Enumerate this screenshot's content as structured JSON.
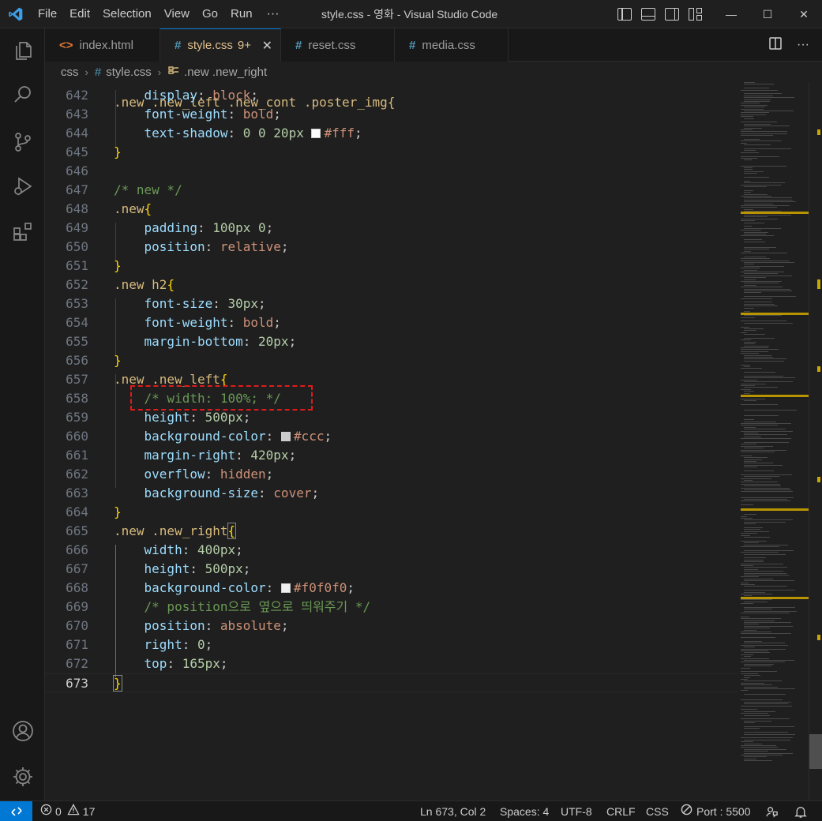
{
  "window": {
    "title": "style.css - 영화 - Visual Studio Code",
    "menu": [
      "File",
      "Edit",
      "Selection",
      "View",
      "Go",
      "Run"
    ],
    "more": "···",
    "controls": {
      "minimize": "—",
      "maximize": "☐",
      "close": "✕"
    }
  },
  "tabs": [
    {
      "label": "index.html",
      "icon": "<>",
      "active": false
    },
    {
      "label": "style.css",
      "icon": "#",
      "badge": "9+",
      "active": true,
      "close": "✕"
    },
    {
      "label": "reset.css",
      "icon": "#",
      "active": false
    },
    {
      "label": "media.css",
      "icon": "#",
      "active": false
    }
  ],
  "breadcrumb": {
    "folder": "css",
    "file": "style.css",
    "symbol": ".new .new_right"
  },
  "editor": {
    "first_partial_line": ".new .new_left .new_cont .poster_img{",
    "line_numbers": [
      "642",
      "643",
      "644",
      "645",
      "646",
      "647",
      "648",
      "649",
      "650",
      "651",
      "652",
      "653",
      "654",
      "655",
      "656",
      "657",
      "658",
      "659",
      "660",
      "661",
      "662",
      "663",
      "664",
      "665",
      "666",
      "667",
      "668",
      "669",
      "670",
      "671",
      "672",
      "673"
    ],
    "current_line": "673",
    "lines": {
      "l642": {
        "prop": "display",
        "value": "block"
      },
      "l643": {
        "prop": "font-weight",
        "value": "bold"
      },
      "l644": {
        "prop": "text-shadow",
        "value": "0 0 20px",
        "color": "#fff"
      },
      "l647": "/* new */",
      "l648": ".new",
      "l649": {
        "prop": "padding",
        "value": "100px 0"
      },
      "l650": {
        "prop": "position",
        "value": "relative"
      },
      "l652": ".new h2",
      "l653": {
        "prop": "font-size",
        "value": "30px"
      },
      "l654": {
        "prop": "font-weight",
        "value": "bold"
      },
      "l655": {
        "prop": "margin-bottom",
        "value": "20px"
      },
      "l657": ".new .new_left",
      "l658": "/* width: 100%; */",
      "l659": {
        "prop": "height",
        "value": "500px"
      },
      "l660": {
        "prop": "background-color",
        "color": "#ccc"
      },
      "l661": {
        "prop": "margin-right",
        "value": "420px"
      },
      "l662": {
        "prop": "overflow",
        "value": "hidden"
      },
      "l663": {
        "prop": "background-size",
        "value": "cover"
      },
      "l665": ".new .new_right",
      "l666": {
        "prop": "width",
        "value": "400px"
      },
      "l667": {
        "prop": "height",
        "value": "500px"
      },
      "l668": {
        "prop": "background-color",
        "color": "#f0f0f0"
      },
      "l669": "/* position으로 옆으로 띄워주기 */",
      "l670": {
        "prop": "position",
        "value": "absolute"
      },
      "l671": {
        "prop": "right",
        "value": "0"
      },
      "l672": {
        "prop": "top",
        "value": "165px"
      }
    }
  },
  "status": {
    "errors": "0",
    "warnings": "17",
    "position": "Ln 673, Col 2",
    "spaces": "Spaces: 4",
    "encoding": "UTF-8",
    "eol": "CRLF",
    "language": "CSS",
    "port": "Port : 5500"
  },
  "colors": {
    "accent": "#0078d4",
    "highlight": "#e01b1b",
    "selector": "#d7ba7d",
    "property": "#9cdcfe",
    "value": "#ce9178",
    "number": "#b5cea8",
    "comment": "#6a9955"
  },
  "icons": [
    "vscode-logo-icon",
    "explorer-icon",
    "search-icon",
    "source-control-icon",
    "run-debug-icon",
    "extensions-icon",
    "account-icon",
    "settings-gear-icon",
    "remote-icon",
    "error-icon",
    "warning-icon",
    "split-editor-icon",
    "more-actions-icon",
    "feedback-icon",
    "bell-icon"
  ]
}
